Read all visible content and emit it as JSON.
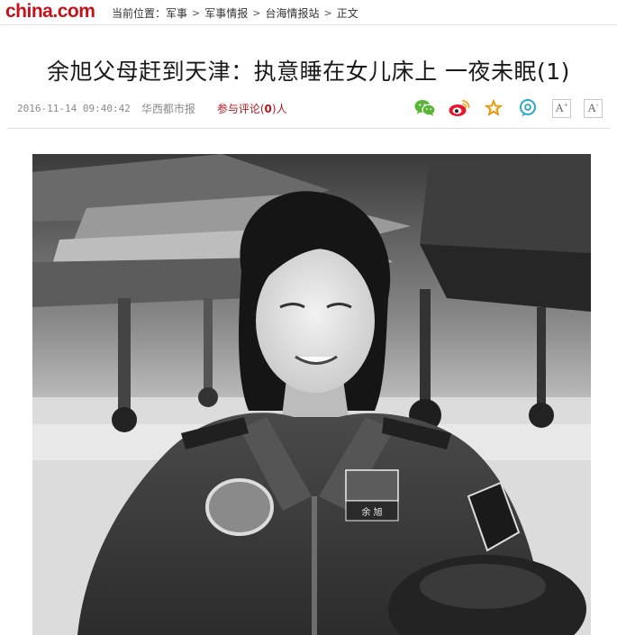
{
  "header": {
    "logo": {
      "main": "china",
      "dot": ".",
      "tld": "com"
    },
    "breadcrumb": {
      "prefix": "当前位置：",
      "items": [
        "军事",
        "军事情报",
        "台海情报站",
        "正文"
      ]
    }
  },
  "article": {
    "title": "余旭父母赶到天津：执意睡在女儿床上 一夜未眠(1)",
    "date": "2016-11-14 09:40:42",
    "source": "华西都市报",
    "comments": {
      "prefix": "参与评论(",
      "count": "0",
      "suffix": ")人"
    }
  },
  "share": {
    "icons": [
      "wechat-icon",
      "weibo-icon",
      "favorite-star-icon",
      "comment-bubble-icon"
    ],
    "font_increase": {
      "letter": "A",
      "sign": "+"
    },
    "font_decrease": {
      "letter": "A",
      "sign": "-"
    }
  },
  "photo": {
    "style": "grayscale",
    "badge_name": "余 旭"
  }
}
